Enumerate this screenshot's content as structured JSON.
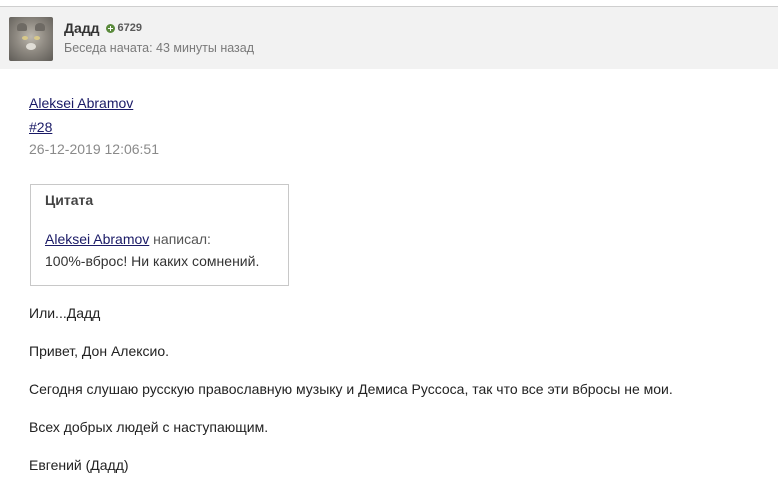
{
  "header": {
    "username": "Дадд",
    "reputation": "6729",
    "subtitle": "Беседа начата: 43 минуты назад"
  },
  "post": {
    "author_link": "Aleksei Abramov",
    "post_number": "#28",
    "timestamp": "26-12-2019 12:06:51",
    "quote": {
      "title": "Цитата",
      "author": "Aleksei Abramov",
      "wrote": "написал:",
      "text": "100%-вброс! Ни каких сомнений."
    },
    "paragraphs": [
      "Или...Дадд",
      "Привет, Дон Алексио.",
      "Сегодня слушаю русскую православную музыку и Демиса Руссоса, так что все эти вбросы не мои.",
      "Всех добрых людей с наступающим.",
      "Евгений (Дадд)"
    ]
  },
  "icons": {
    "reputation": "plus-circle-icon",
    "avatar": "cat-avatar"
  }
}
